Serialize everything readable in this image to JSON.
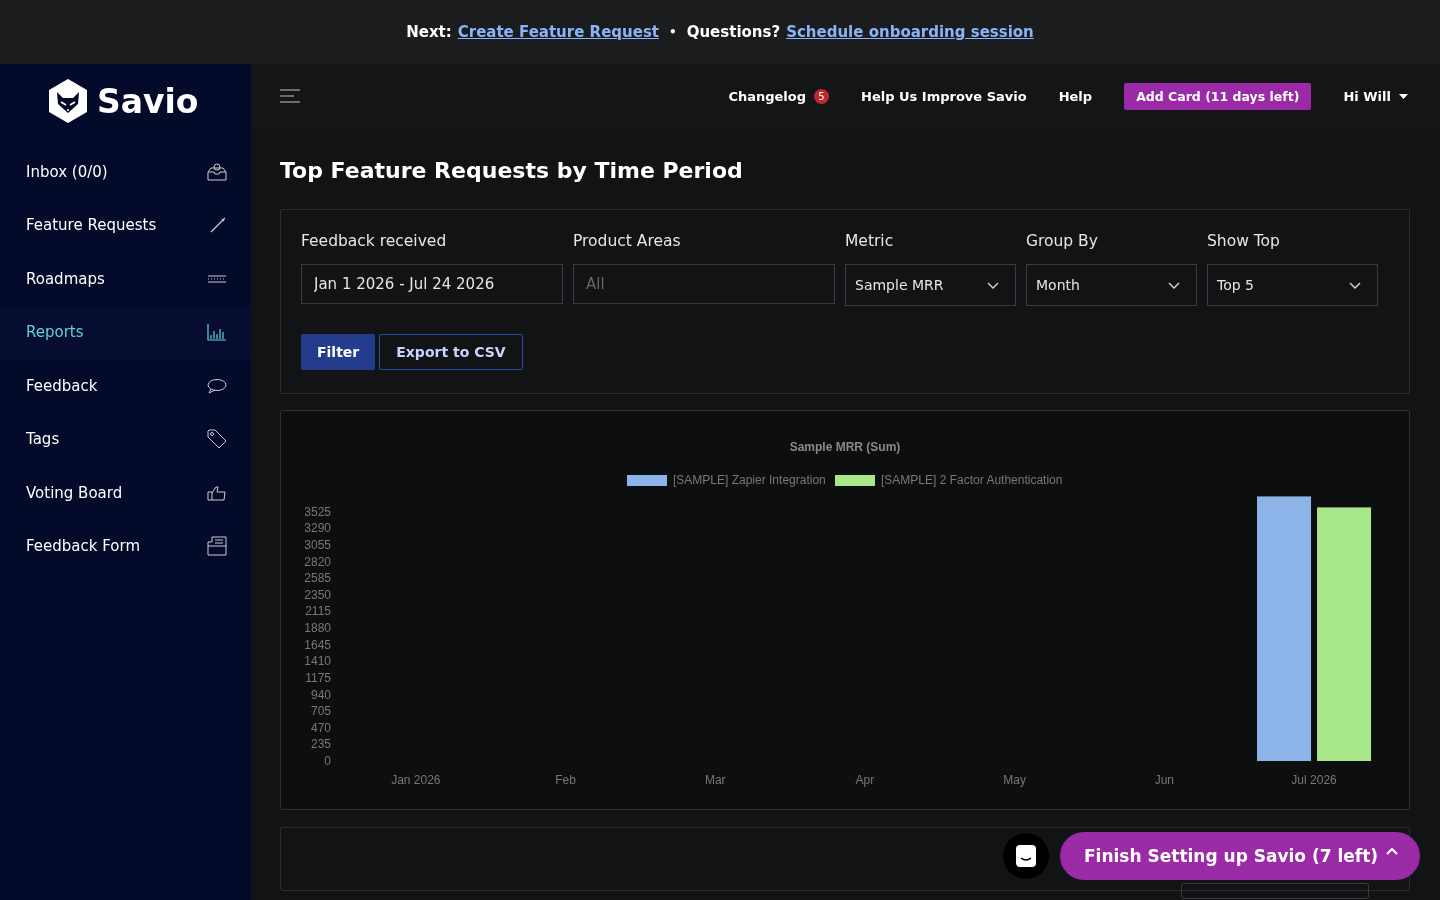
{
  "banner": {
    "next_label": "Next:",
    "next_link": "Create Feature Request",
    "separator": "•",
    "questions_label": "Questions?",
    "questions_link": "Schedule onboarding session"
  },
  "sidebar": {
    "logo": "Savio",
    "items": [
      {
        "label": "Inbox (0/0)",
        "selected": false
      },
      {
        "label": "Feature Requests",
        "selected": false
      },
      {
        "label": "Roadmaps",
        "selected": false
      },
      {
        "label": "Reports",
        "selected": true
      },
      {
        "label": "Feedback",
        "selected": false
      },
      {
        "label": "Tags",
        "selected": false
      },
      {
        "label": "Voting Board",
        "selected": false
      },
      {
        "label": "Feedback Form",
        "selected": false
      }
    ]
  },
  "header": {
    "changelog": "Changelog",
    "changelog_badge": "5",
    "improve": "Help Us Improve Savio",
    "help": "Help",
    "add_card": "Add Card (11 days left)",
    "user": "Hi Will"
  },
  "page_title": "Top Feature Requests by Time Period",
  "filters": [
    {
      "kind": "input",
      "label": "Feedback received",
      "value": "Jan 1 2026 - Jul 24 2026"
    },
    {
      "kind": "input",
      "label": "Product Areas",
      "placeholder": "All"
    },
    {
      "kind": "select",
      "label": "Metric",
      "value": "Sample MRR"
    },
    {
      "kind": "select",
      "label": "Group By",
      "value": "Month"
    },
    {
      "kind": "select",
      "label": "Show Top",
      "value": "Top 5"
    }
  ],
  "actions": {
    "filter": "Filter",
    "export": "Export to CSV"
  },
  "chart": {
    "chart_data": {
      "type": "bar",
      "title": "Sample MRR (Sum)",
      "legend": true,
      "ylim": [
        0,
        3760
      ],
      "categories": [
        "Jan 2026",
        "Feb",
        "Mar",
        "Apr",
        "May",
        "Jun",
        "Jul 2026"
      ],
      "series": [
        {
          "name": "[SAMPLE] Zapier Integration",
          "color": "#8db4e8",
          "values": [
            0,
            0,
            0,
            0,
            0,
            0,
            3740
          ]
        },
        {
          "name": "[SAMPLE] 2 Factor Authentication",
          "color": "#a8e88a",
          "values": [
            0,
            0,
            0,
            0,
            0,
            0,
            3585
          ]
        }
      ],
      "yticks": [
        0,
        235,
        470,
        705,
        940,
        1175,
        1410,
        1645,
        1880,
        2115,
        2350,
        2585,
        2820,
        3055,
        3290,
        3525
      ]
    }
  },
  "widget": {
    "label": "Finish Setting up Savio (7 left)"
  }
}
